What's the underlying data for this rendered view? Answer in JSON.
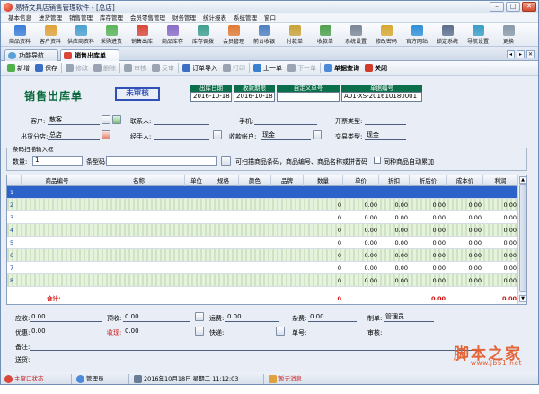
{
  "window": {
    "title": "易特文具店销售管理软件 - [总店]"
  },
  "menu": [
    "基本信息",
    "进货管理",
    "销售管理",
    "库存管理",
    "会员零售管理",
    "财务管理",
    "统计报表",
    "系统管理",
    "窗口"
  ],
  "main_toolbar": [
    {
      "label": "商品资料",
      "color": "#3b7dd8"
    },
    {
      "label": "客户资料",
      "color": "#e0a23a"
    },
    {
      "label": "供应商资料",
      "color": "#4aa0d0"
    },
    {
      "label": "采购进货",
      "color": "#5bb35a"
    },
    {
      "label": "销售出库",
      "color": "#d9483a"
    },
    {
      "label": "商品库存",
      "color": "#8a6cc8"
    },
    {
      "label": "库存调拨",
      "color": "#3f9f8f"
    },
    {
      "label": "会员管理",
      "color": "#e07b35"
    },
    {
      "label": "前台收银",
      "color": "#4e7fc2"
    },
    {
      "label": "付款单",
      "color": "#c9a23a"
    },
    {
      "label": "收款单",
      "color": "#4fa04d"
    },
    {
      "label": "系统设置",
      "color": "#7b8696"
    },
    {
      "label": "修改密码",
      "color": "#d7a830"
    },
    {
      "label": "官方网站",
      "color": "#2f8fd8"
    },
    {
      "label": "锁定系统",
      "color": "#5c6f8c"
    },
    {
      "label": "导航设置",
      "color": "#3a9dc6"
    },
    {
      "label": "更换",
      "color": "#8899aa"
    }
  ],
  "tabs": [
    {
      "label": "功能导航",
      "active": false
    },
    {
      "label": "销售出库单",
      "active": true
    }
  ],
  "form_toolbar": [
    {
      "label": "新增",
      "color": "#4fb04c",
      "disabled": false,
      "bold": false
    },
    {
      "label": "保存",
      "color": "#3a6fc4",
      "disabled": false,
      "bold": false
    },
    {
      "label": "修改",
      "color": "#9aa4b2",
      "disabled": true,
      "bold": false
    },
    {
      "label": "删除",
      "color": "#9aa4b2",
      "disabled": true,
      "bold": false
    },
    {
      "label": "审核",
      "color": "#9aa4b2",
      "disabled": true,
      "bold": false
    },
    {
      "label": "反审",
      "color": "#9aa4b2",
      "disabled": true,
      "bold": false
    },
    {
      "label": "订单导入",
      "color": "#3a6fc4",
      "disabled": false,
      "bold": false
    },
    {
      "label": "打印",
      "color": "#9aa4b2",
      "disabled": true,
      "bold": false
    },
    {
      "label": "上一单",
      "color": "#3a7fd0",
      "disabled": false,
      "bold": false
    },
    {
      "label": "下一单",
      "color": "#9aa4b2",
      "disabled": true,
      "bold": false
    },
    {
      "label": "单据查询",
      "color": "#4a8ad8",
      "disabled": false,
      "bold": true
    },
    {
      "label": "关闭",
      "color": "#d23a2a",
      "disabled": false,
      "bold": true
    }
  ],
  "header": {
    "title": "销售出库单",
    "stamp": "未审核",
    "date_boxes": [
      {
        "label": "出库日期",
        "value": "2016-10-18"
      },
      {
        "label": "收款期限",
        "value": "2016-10-18"
      },
      {
        "label": "自定义单号",
        "value": ""
      },
      {
        "label": "单据编号",
        "value": "A01-XS-201610180001"
      }
    ]
  },
  "fields": {
    "customer_label": "客户:",
    "customer_value": "散客",
    "contact_label": "联系人:",
    "contact_value": "",
    "phone_label": "手机:",
    "phone_value": "",
    "invoice_label": "开票类型:",
    "invoice_value": "",
    "branch_label": "出货分店:",
    "branch_value": "总店",
    "handler_label": "经手人:",
    "handler_value": "",
    "account_label": "收款帐户:",
    "account_value": "现金",
    "trade_label": "交易类型:",
    "trade_value": "现金"
  },
  "barcode": {
    "legend": "条码扫描输入框",
    "qty_label": "数量:",
    "qty_value": "1",
    "code_label": "条型码:",
    "code_value": "",
    "hint": "可扫描商品条码，商品编号、商品名称或拼音码",
    "merge_label": "同种商品自动累加"
  },
  "grid": {
    "columns": [
      "",
      "商品编号",
      "名称",
      "单位",
      "规格",
      "颜色",
      "品牌",
      "数量",
      "单价",
      "折扣",
      "折后价",
      "成本价",
      "利润"
    ],
    "rows": [
      {
        "n": "1",
        "qty": "",
        "price": "",
        "disc": "",
        "after": "",
        "cost": "",
        "profit": ""
      },
      {
        "n": "2",
        "qty": "0",
        "price": "0.00",
        "disc": "0.00",
        "after": "0.00",
        "cost": "0.00",
        "profit": "0.00"
      },
      {
        "n": "3",
        "qty": "0",
        "price": "0.00",
        "disc": "0.00",
        "after": "0.00",
        "cost": "0.00",
        "profit": "0.00"
      },
      {
        "n": "4",
        "qty": "0",
        "price": "0.00",
        "disc": "0.00",
        "after": "0.00",
        "cost": "0.00",
        "profit": "0.00"
      },
      {
        "n": "5",
        "qty": "0",
        "price": "0.00",
        "disc": "0.00",
        "after": "0.00",
        "cost": "0.00",
        "profit": "0.00"
      },
      {
        "n": "6",
        "qty": "0",
        "price": "0.00",
        "disc": "0.00",
        "after": "0.00",
        "cost": "0.00",
        "profit": "0.00"
      },
      {
        "n": "7",
        "qty": "0",
        "price": "0.00",
        "disc": "0.00",
        "after": "0.00",
        "cost": "0.00",
        "profit": "0.00"
      },
      {
        "n": "8",
        "qty": "0",
        "price": "0.00",
        "disc": "0.00",
        "after": "0.00",
        "cost": "0.00",
        "profit": "0.00"
      }
    ],
    "total": {
      "label": "合计:",
      "qty": "0",
      "after": "0.00",
      "profit": "0.00"
    }
  },
  "bottom": {
    "receivable_label": "应收:",
    "receivable_value": "0.00",
    "prepaid_label": "预收:",
    "prepaid_value": "0.00",
    "freight_label": "运费:",
    "freight_value": "0.00",
    "misc_label": "杂费:",
    "misc_value": "0.00",
    "maker_label": "制单:",
    "maker_value": "管理员",
    "discount_label": "优惠:",
    "discount_value": "0.00",
    "received_label": "收现:",
    "received_value": "0.00",
    "express_label": "快递:",
    "express_value": "",
    "trackno_label": "单号:",
    "trackno_value": "",
    "auditor_label": "审核:",
    "auditor_value": "",
    "remark_label": "备注:",
    "remark_value": "",
    "address_label": "送货:",
    "address_value": ""
  },
  "statusbar": {
    "items": [
      "主窗口状态",
      "管理员",
      "2016年10月18日 星期二   11:12:03",
      "暂无消息"
    ]
  },
  "watermark": {
    "title": "脚本之家",
    "url": "www.jb51.net"
  }
}
